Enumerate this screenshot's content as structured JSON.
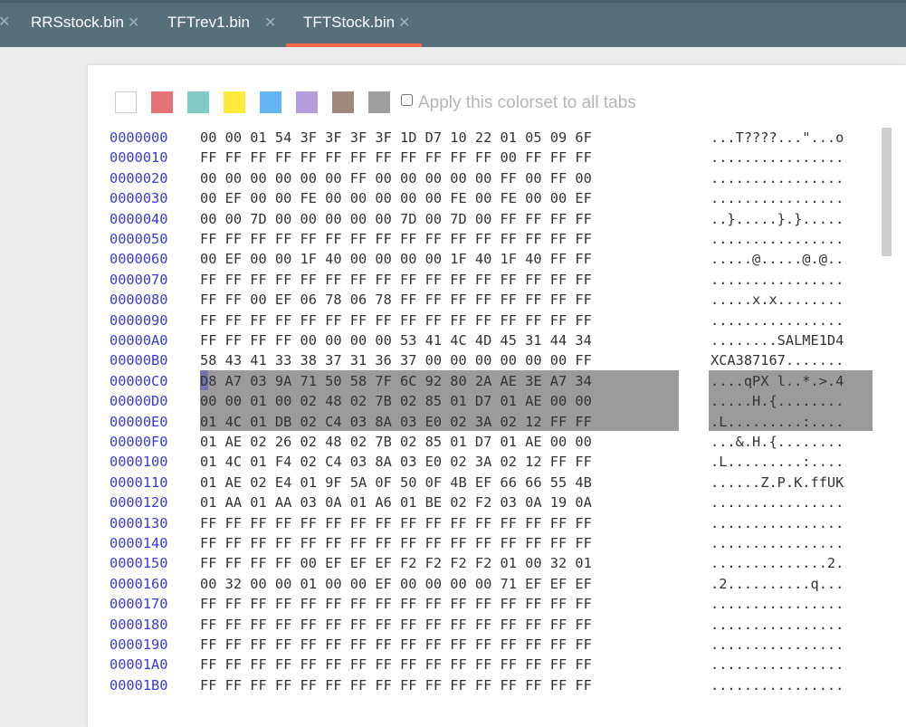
{
  "tabs": [
    {
      "label": "RRSstock.bin",
      "close": "✕"
    },
    {
      "label": "TFTrev1.bin",
      "close": "✕"
    },
    {
      "label": "TFTStock.bin",
      "close": "✕",
      "active": true
    }
  ],
  "leading_close": "✕",
  "colorset": {
    "swatches": [
      "#ffffff",
      "#e57373",
      "#80cbc4",
      "#ffeb3b",
      "#64b5f6",
      "#b39ddb",
      "#a1887f",
      "#9e9e9e"
    ],
    "apply_label": "Apply this colorset to all tabs",
    "selection_color": "#9b9b9b"
  },
  "hex_view": {
    "rows": [
      {
        "addr": "0000000",
        "bytes": "00 00 01 54 3F 3F 3F 3F 1D D7 10 22 01 05 09 6F",
        "ascii": "...T????...\"...o"
      },
      {
        "addr": "0000010",
        "bytes": "FF FF FF FF FF FF FF FF FF FF FF FF 00 FF FF FF",
        "ascii": "................"
      },
      {
        "addr": "0000020",
        "bytes": "00 00 00 00 00 00 FF 00 00 00 00 00 FF 00 FF 00",
        "ascii": "................"
      },
      {
        "addr": "0000030",
        "bytes": "00 EF 00 00 FE 00 00 00 00 00 FE 00 FE 00 00 EF",
        "ascii": "................"
      },
      {
        "addr": "0000040",
        "bytes": "00 00 7D 00 00 00 00 00 7D 00 7D 00 FF FF FF FF",
        "ascii": "..}.....}.}....."
      },
      {
        "addr": "0000050",
        "bytes": "FF FF FF FF FF FF FF FF FF FF FF FF FF FF FF FF",
        "ascii": "................"
      },
      {
        "addr": "0000060",
        "bytes": "00 EF 00 00 1F 40 00 00 00 00 1F 40 1F 40 FF FF",
        "ascii": ".....@.....@.@.."
      },
      {
        "addr": "0000070",
        "bytes": "FF FF FF FF FF FF FF FF FF FF FF FF FF FF FF FF",
        "ascii": "................"
      },
      {
        "addr": "0000080",
        "bytes": "FF FF 00 EF 06 78 06 78 FF FF FF FF FF FF FF FF",
        "ascii": ".....x.x........"
      },
      {
        "addr": "0000090",
        "bytes": "FF FF FF FF FF FF FF FF FF FF FF FF FF FF FF FF",
        "ascii": "................"
      },
      {
        "addr": "00000A0",
        "bytes": "FF FF FF FF 00 00 00 00 53 41 4C 4D 45 31 44 34",
        "ascii": "........SALME1D4"
      },
      {
        "addr": "00000B0",
        "bytes": "58 43 41 33 38 37 31 36 37 00 00 00 00 00 00 FF",
        "ascii": "XCA387167......."
      },
      {
        "addr": "00000C0",
        "bytes": "D8 A7 03 9A 71 50 58 7F 6C 92 80 2A AE 3E A7 34",
        "ascii": "....qPX l..*.>.4"
      },
      {
        "addr": "00000D0",
        "bytes": "00 00 01 00 02 48 02 7B 02 85 01 D7 01 AE 00 00",
        "ascii": ".....H.{........"
      },
      {
        "addr": "00000E0",
        "bytes": "01 4C 01 DB 02 C4 03 8A 03 E0 02 3A 02 12 FF FF",
        "ascii": ".L.........:...."
      },
      {
        "addr": "00000F0",
        "bytes": "01 AE 02 26 02 48 02 7B 02 85 01 D7 01 AE 00 00",
        "ascii": "...&.H.{........"
      },
      {
        "addr": "0000100",
        "bytes": "01 4C 01 F4 02 C4 03 8A 03 E0 02 3A 02 12 FF FF",
        "ascii": ".L.........:...."
      },
      {
        "addr": "0000110",
        "bytes": "01 AE 02 E4 01 9F 5A 0F 50 0F 4B EF 66 66 55 4B",
        "ascii": "......Z.P.K.ffUK"
      },
      {
        "addr": "0000120",
        "bytes": "01 AA 01 AA 03 0A 01 A6 01 BE 02 F2 03 0A 19 0A",
        "ascii": "................"
      },
      {
        "addr": "0000130",
        "bytes": "FF FF FF FF FF FF FF FF FF FF FF FF FF FF FF FF",
        "ascii": "................"
      },
      {
        "addr": "0000140",
        "bytes": "FF FF FF FF FF FF FF FF FF FF FF FF FF FF FF FF",
        "ascii": "................"
      },
      {
        "addr": "0000150",
        "bytes": "FF FF FF FF 00 EF EF EF F2 F2 F2 F2 01 00 32 01",
        "ascii": "..............2."
      },
      {
        "addr": "0000160",
        "bytes": "00 32 00 00 01 00 00 EF 00 00 00 00 71 EF EF EF",
        "ascii": ".2..........q..."
      },
      {
        "addr": "0000170",
        "bytes": "FF FF FF FF FF FF FF FF FF FF FF FF FF FF FF FF",
        "ascii": "................"
      },
      {
        "addr": "0000180",
        "bytes": "FF FF FF FF FF FF FF FF FF FF FF FF FF FF FF FF",
        "ascii": "................"
      },
      {
        "addr": "0000190",
        "bytes": "FF FF FF FF FF FF FF FF FF FF FF FF FF FF FF FF",
        "ascii": "................"
      },
      {
        "addr": "00001A0",
        "bytes": "FF FF FF FF FF FF FF FF FF FF FF FF FF FF FF FF",
        "ascii": "................"
      },
      {
        "addr": "00001B0",
        "bytes": "FF FF FF FF FF FF FF FF FF FF FF FF FF FF FF FF",
        "ascii": "................"
      }
    ]
  }
}
